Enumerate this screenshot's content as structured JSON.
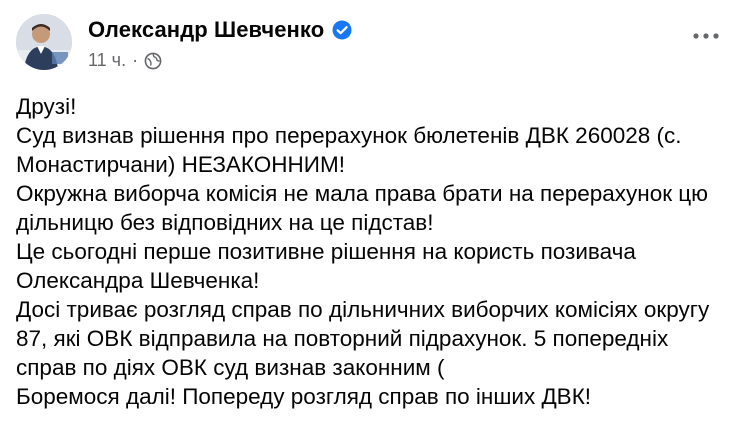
{
  "post": {
    "author": "Олександр Шевченко",
    "time": "11 ч.",
    "separator": "·",
    "icons": {
      "verified": "verified-badge-icon",
      "audience": "globe-icon",
      "more": "more-options-icon"
    },
    "accent_color": "#1877f2",
    "lines": [
      "Друзі!",
      "Суд визнав рішення про перерахунок бюлетенів ДВК 260028 (с.",
      "Монастирчани) НЕЗАКОННИМ!",
      "Окружна виборча комісія не мала права брати на перерахунок цю",
      "дільницю без відповідних на це підстав!",
      "Це сьогодні перше позитивне рішення на користь позивача",
      "Олександра Шевченка!",
      "Досі триває розгляд справ по дільничних виборчих комісіях округу",
      "87, які ОВК відправила на повторний підрахунок. 5 попередніх",
      "справ по діях ОВК суд визнав законним (",
      "Боремося далі! Попереду розгляд справ по інших ДВК!"
    ]
  }
}
